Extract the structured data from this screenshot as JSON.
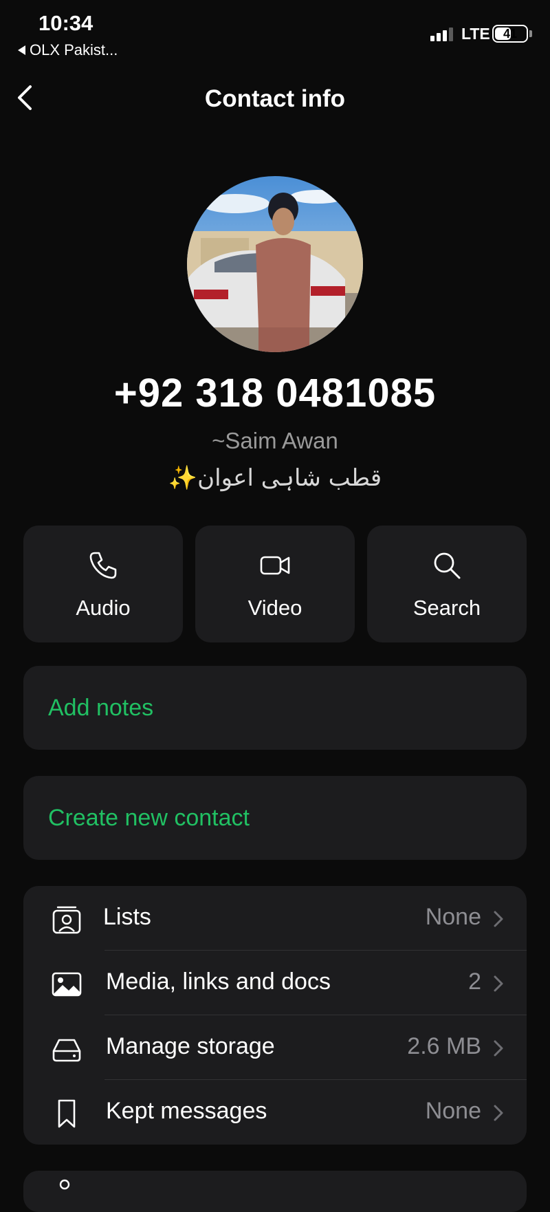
{
  "status_bar": {
    "time": "10:34",
    "back_app": "OLX Pakist...",
    "network": "LTE",
    "battery": "41"
  },
  "header": {
    "title": "Contact info"
  },
  "profile": {
    "phone": "+92 318 0481085",
    "push_name": "~Saim Awan",
    "about": "قطب شاہی اعوان✨"
  },
  "actions": [
    {
      "label": "Audio",
      "icon": "phone-icon"
    },
    {
      "label": "Video",
      "icon": "video-icon"
    },
    {
      "label": "Search",
      "icon": "search-icon"
    }
  ],
  "notes": {
    "label": "Add notes"
  },
  "create_contact": {
    "label": "Create new contact"
  },
  "settings_list": [
    {
      "label": "Lists",
      "value": "None",
      "icon": "lists-icon"
    },
    {
      "label": "Media, links and docs",
      "value": "2",
      "icon": "image-icon"
    },
    {
      "label": "Manage storage",
      "value": "2.6 MB",
      "icon": "storage-icon"
    },
    {
      "label": "Kept messages",
      "value": "None",
      "icon": "bookmark-icon"
    }
  ],
  "colors": {
    "accent": "#21c063",
    "card": "#1c1c1e",
    "background": "#0b0b0b"
  }
}
